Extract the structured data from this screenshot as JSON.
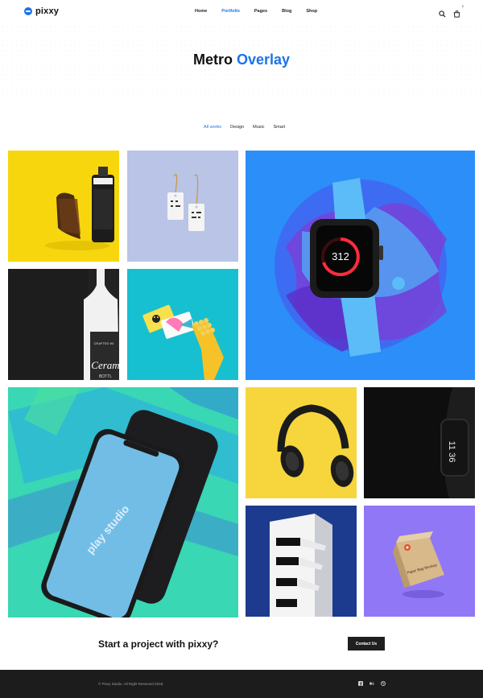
{
  "brand": {
    "name": "pixxy"
  },
  "nav": {
    "items": [
      {
        "label": "Home"
      },
      {
        "label": "Portfolio"
      },
      {
        "label": "Pages"
      },
      {
        "label": "Blog"
      },
      {
        "label": "Shop"
      }
    ],
    "active": "Portfolio"
  },
  "header": {
    "cart_count": "0"
  },
  "hero": {
    "title_part1": "Metro",
    "title_part2": "Overlay"
  },
  "filters": [
    {
      "label": "All works"
    },
    {
      "label": "Design"
    },
    {
      "label": "Music"
    },
    {
      "label": "Smart"
    }
  ],
  "portfolio": {
    "items": [
      {
        "subject": "film-roll"
      },
      {
        "subject": "hang-tags"
      },
      {
        "subject": "smart-watch"
      },
      {
        "subject": "ceramic-bottle"
      },
      {
        "subject": "business-cards"
      },
      {
        "subject": "smartphone"
      },
      {
        "subject": "headphones"
      },
      {
        "subject": "fitness-band"
      },
      {
        "subject": "building"
      },
      {
        "subject": "paper-bag"
      }
    ]
  },
  "mockup_text": {
    "watch_reading": "312",
    "bottle_label": "Ceram",
    "bottle_top": "CRAFTED WI",
    "bottle_bottom": "BOTTL",
    "phone_screen": "play studio",
    "band_digits": "11 36",
    "bag_label": "Paper Bag Mockup"
  },
  "cta": {
    "text": "Start a project with pixxy?",
    "button_label": "Contact Us"
  },
  "footer": {
    "copyright": "© Pixxy Studio. All Right Reserved 2018."
  },
  "colors": {
    "accent": "#1a73e8",
    "footer_bg": "#1c1c1c"
  }
}
